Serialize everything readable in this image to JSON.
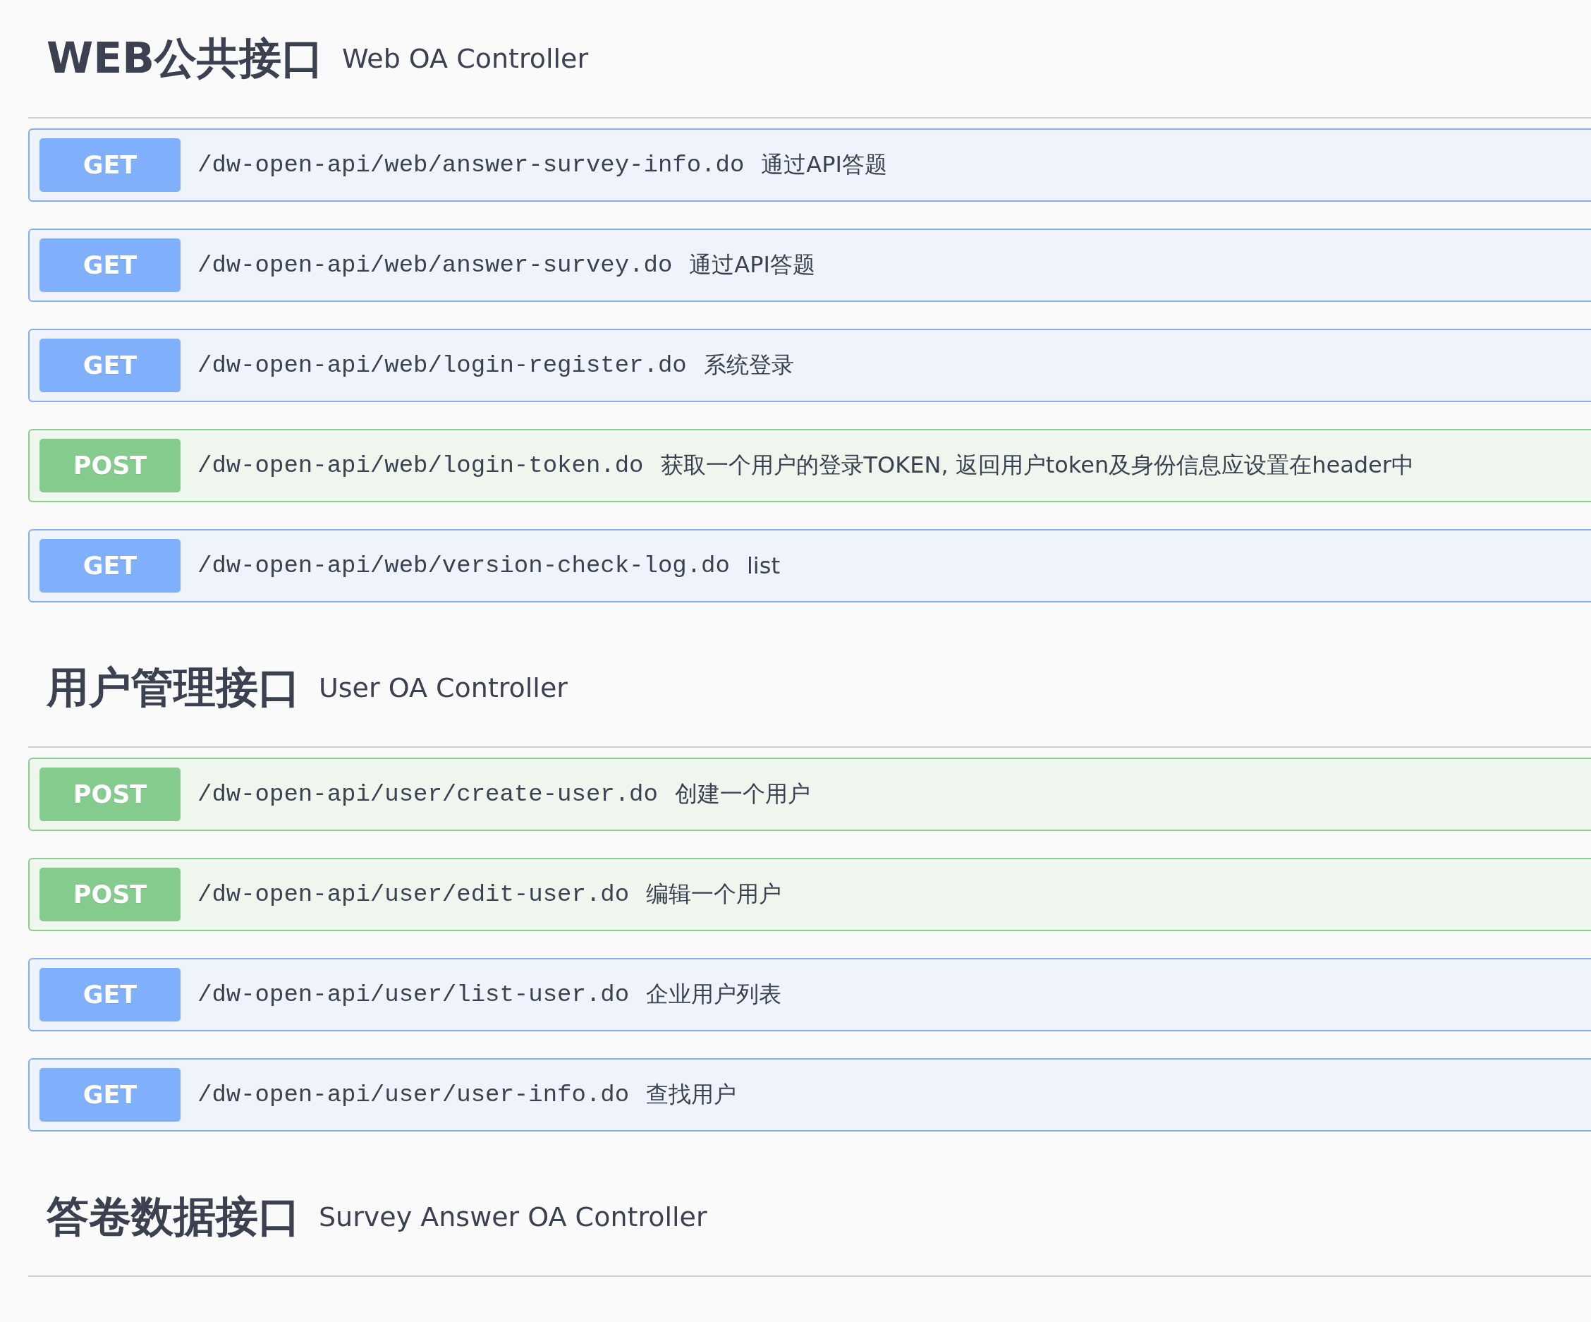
{
  "sections": [
    {
      "title": "WEB公共接口",
      "subtitle": "Web OA Controller",
      "endpoints": [
        {
          "kind": "get",
          "method": "GET",
          "path": "/dw-open-api/web/answer-survey-info.do",
          "summary": "通过API答题"
        },
        {
          "kind": "get",
          "method": "GET",
          "path": "/dw-open-api/web/answer-survey.do",
          "summary": "通过API答题"
        },
        {
          "kind": "get",
          "method": "GET",
          "path": "/dw-open-api/web/login-register.do",
          "summary": "系统登录"
        },
        {
          "kind": "post",
          "method": "POST",
          "path": "/dw-open-api/web/login-token.do",
          "summary": "获取一个用户的登录TOKEN, 返回用户token及身份信息应设置在header中"
        },
        {
          "kind": "get",
          "method": "GET",
          "path": "/dw-open-api/web/version-check-log.do",
          "summary": "list"
        }
      ]
    },
    {
      "title": "用户管理接口",
      "subtitle": "User OA Controller",
      "endpoints": [
        {
          "kind": "post",
          "method": "POST",
          "path": "/dw-open-api/user/create-user.do",
          "summary": "创建一个用户"
        },
        {
          "kind": "post",
          "method": "POST",
          "path": "/dw-open-api/user/edit-user.do",
          "summary": "编辑一个用户"
        },
        {
          "kind": "get",
          "method": "GET",
          "path": "/dw-open-api/user/list-user.do",
          "summary": "企业用户列表"
        },
        {
          "kind": "get",
          "method": "GET",
          "path": "/dw-open-api/user/user-info.do",
          "summary": "查找用户"
        }
      ]
    },
    {
      "title": "答卷数据接口",
      "subtitle": "Survey Answer OA Controller"
    }
  ]
}
